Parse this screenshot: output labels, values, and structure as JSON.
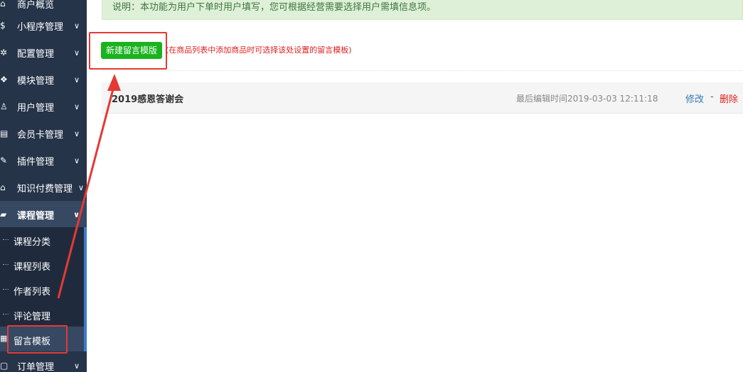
{
  "sidebar": {
    "items": [
      {
        "label": "商户概览",
        "icon": "home-icon"
      },
      {
        "label": "小程序管理",
        "icon": "dollar-icon"
      },
      {
        "label": "配置管理",
        "icon": "cog-icon"
      },
      {
        "label": "模块管理",
        "icon": "cubes-icon"
      },
      {
        "label": "用户管理",
        "icon": "user-icon"
      },
      {
        "label": "会员卡管理",
        "icon": "card-icon"
      },
      {
        "label": "插件管理",
        "icon": "plug-icon"
      },
      {
        "label": "知识付费管理",
        "icon": "home-icon"
      },
      {
        "label": "课程管理",
        "icon": "cart-icon"
      },
      {
        "label": "订单管理",
        "icon": "tag-icon"
      }
    ],
    "sub_items": [
      {
        "label": "课程分类"
      },
      {
        "label": "课程列表"
      },
      {
        "label": "作者列表"
      },
      {
        "label": "评论管理"
      },
      {
        "label": "留言模板"
      }
    ]
  },
  "notice": {
    "text": "说明：本功能为用户下单时用户填写，您可根据经营需要选择用户需填信息项。"
  },
  "toolbar": {
    "new_button": "新建留言模版",
    "hint": "(在商品列表中添加商品时可选择该处设置的留言模板)"
  },
  "templates": [
    {
      "name": "2019感恩答谢会",
      "edited": "最后编辑时间2019-03-03 12:11:18",
      "edit_label": "修改",
      "sep": "-",
      "delete_label": "删除"
    }
  ],
  "colors": {
    "sidebar_bg": "#26344a",
    "accent_green": "#19b31f",
    "annotation_red": "#e53935"
  }
}
